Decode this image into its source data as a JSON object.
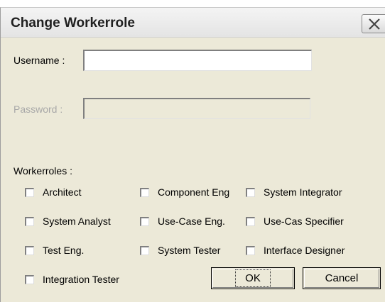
{
  "window": {
    "title": "Change Workerrole"
  },
  "form": {
    "username_label": "Username :",
    "username_value": "",
    "password_label": "Password :",
    "password_value": ""
  },
  "workerroles": {
    "heading": "Workerroles :",
    "items": [
      {
        "label": "Architect",
        "checked": false
      },
      {
        "label": "Component Eng",
        "checked": false
      },
      {
        "label": "System Integrator",
        "checked": false
      },
      {
        "label": "System Analyst",
        "checked": false
      },
      {
        "label": "Use-Case Eng.",
        "checked": false
      },
      {
        "label": "Use-Cas Specifier",
        "checked": false
      },
      {
        "label": "Test Eng.",
        "checked": false
      },
      {
        "label": "System Tester",
        "checked": false
      },
      {
        "label": "Interface Designer",
        "checked": false
      },
      {
        "label": "Integration Tester",
        "checked": false
      }
    ]
  },
  "buttons": {
    "ok_label": "OK",
    "cancel_label": "Cancel"
  },
  "icons": {
    "close": "close-icon"
  }
}
